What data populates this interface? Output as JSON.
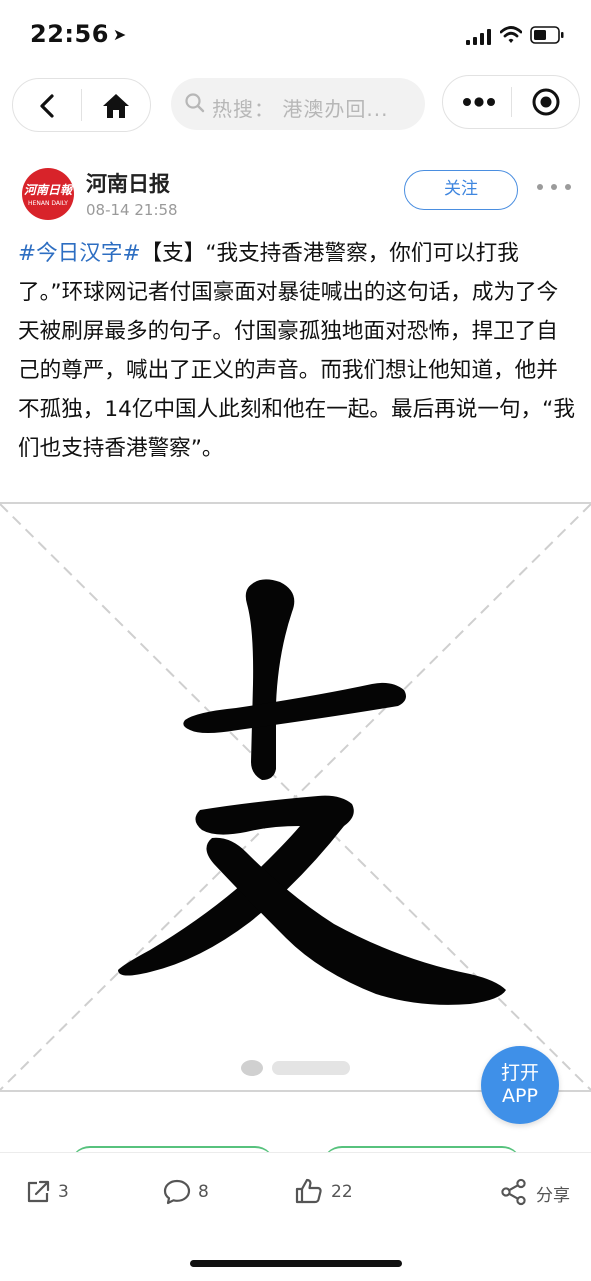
{
  "status_bar": {
    "time": "22:56",
    "location_arrow": "➤"
  },
  "nav": {
    "back_icon": "chevron-left-icon",
    "home_icon": "home-icon",
    "search_placeholder": "热搜：  港澳办回...",
    "more_icon": "more-dots-icon",
    "close_icon": "target-circle-icon"
  },
  "post": {
    "author": {
      "name": "河南日报",
      "avatar_text": "河南日報",
      "avatar_sub": "HENAN DAILY"
    },
    "time": "08-14 21:58",
    "follow_label": "关注",
    "topic": "#今日汉字#",
    "text": "【支】“我支持香港警察，你们可以打我了。”环球网记者付国豪面对暴徒喊出的这句话，成为了今天被刷屏最多的句子。付国豪孤独地面对恐怖，捍卫了自己的尊严，喊出了正义的声音。而我们想让他知道，他并不孤独，14亿中国人此刻和他在一起。最后再说一句，“我们也支持香港警察”。",
    "image_character": "支"
  },
  "open_app": {
    "line1": "打开",
    "line2": "APP"
  },
  "actions": {
    "repost": {
      "icon": "share-out-icon",
      "count": "3"
    },
    "comment": {
      "icon": "comment-icon",
      "count": "8"
    },
    "like": {
      "icon": "thumbs-up-icon",
      "count": "22"
    },
    "share": {
      "icon": "share-nodes-icon",
      "label": "分享"
    }
  },
  "colors": {
    "accent": "#3f86df",
    "topic": "#2d6ec2",
    "brand_red": "#d8232a",
    "open_app": "#3f90e8"
  }
}
